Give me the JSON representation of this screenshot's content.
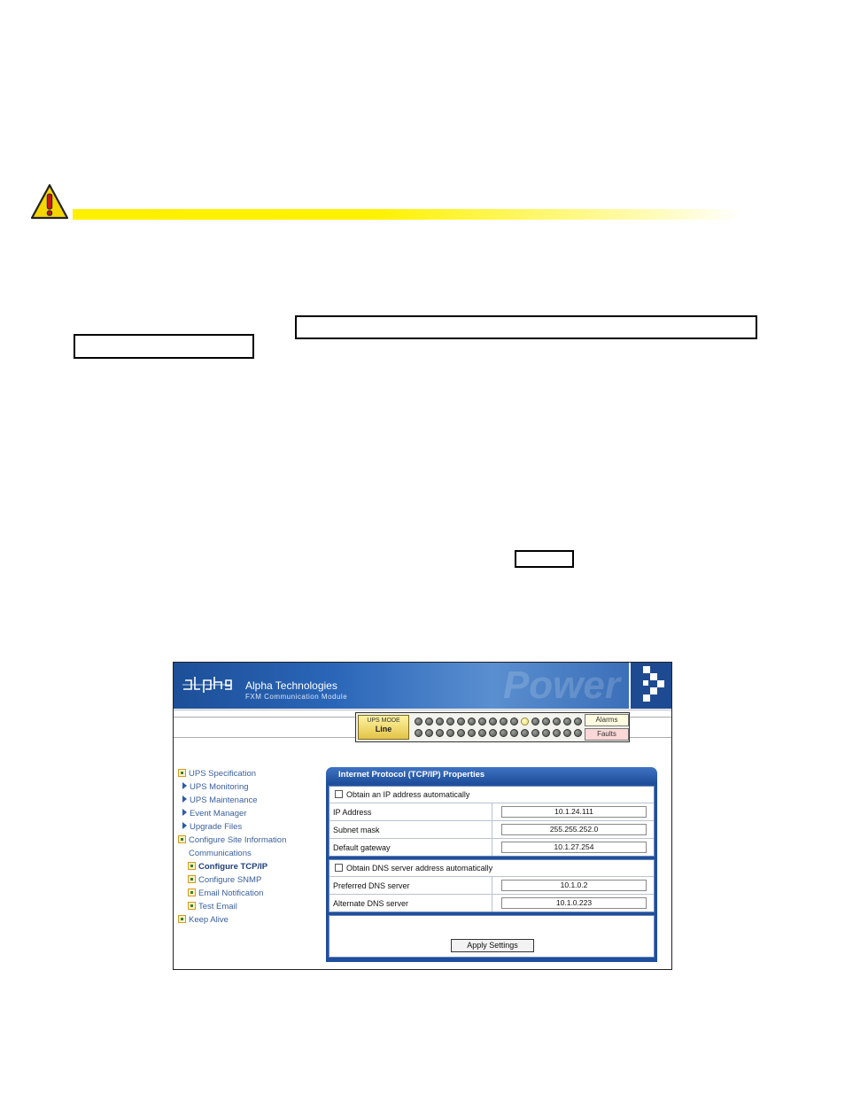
{
  "header": {
    "brand": "Alpha Technologies",
    "subtitle": "FXM Communication Module",
    "watermark": "Power"
  },
  "status_bar": {
    "mode_label": "UPS MODE",
    "mode_value": "Line",
    "alarms_label": "Alarms",
    "faults_label": "Faults",
    "led_count_per_row": 16,
    "lit_led": {
      "row": 1,
      "index": 10
    }
  },
  "sidebar": {
    "items": [
      {
        "label": "UPS Specification",
        "icon": "box-icon"
      },
      {
        "label": "UPS Monitoring",
        "icon": "triangle-icon"
      },
      {
        "label": "UPS Maintenance",
        "icon": "triangle-icon"
      },
      {
        "label": "Event Manager",
        "icon": "triangle-icon"
      },
      {
        "label": "Upgrade Files",
        "icon": "triangle-icon"
      },
      {
        "label": "Configure Site Information",
        "icon": "box-icon"
      },
      {
        "label": "Communications",
        "icon": "none"
      },
      {
        "label": "Configure TCP/IP",
        "icon": "box-icon"
      },
      {
        "label": "Configure SNMP",
        "icon": "box-icon"
      },
      {
        "label": "Email Notification",
        "icon": "box-icon"
      },
      {
        "label": "Test Email",
        "icon": "box-icon"
      },
      {
        "label": "Keep Alive",
        "icon": "box-icon"
      }
    ]
  },
  "tcpip": {
    "title": "Internet Protocol (TCP/IP) Properties",
    "obtain_ip_label": "Obtain an IP address automatically",
    "ip_label": "IP Address",
    "ip_value": "10.1.24.111",
    "subnet_label": "Subnet mask",
    "subnet_value": "255.255.252.0",
    "gateway_label": "Default gateway",
    "gateway_value": "10.1.27.254",
    "obtain_dns_label": "Obtain DNS server address automatically",
    "pref_dns_label": "Preferred DNS server",
    "pref_dns_value": "10.1.0.2",
    "alt_dns_label": "Alternate DNS server",
    "alt_dns_value": "10.1.0.223",
    "apply_label": "Apply Settings"
  },
  "colors": {
    "caution_yellow": "#fff000",
    "header_blue": "#1d4f98",
    "nav_link": "#3a5f9c"
  }
}
